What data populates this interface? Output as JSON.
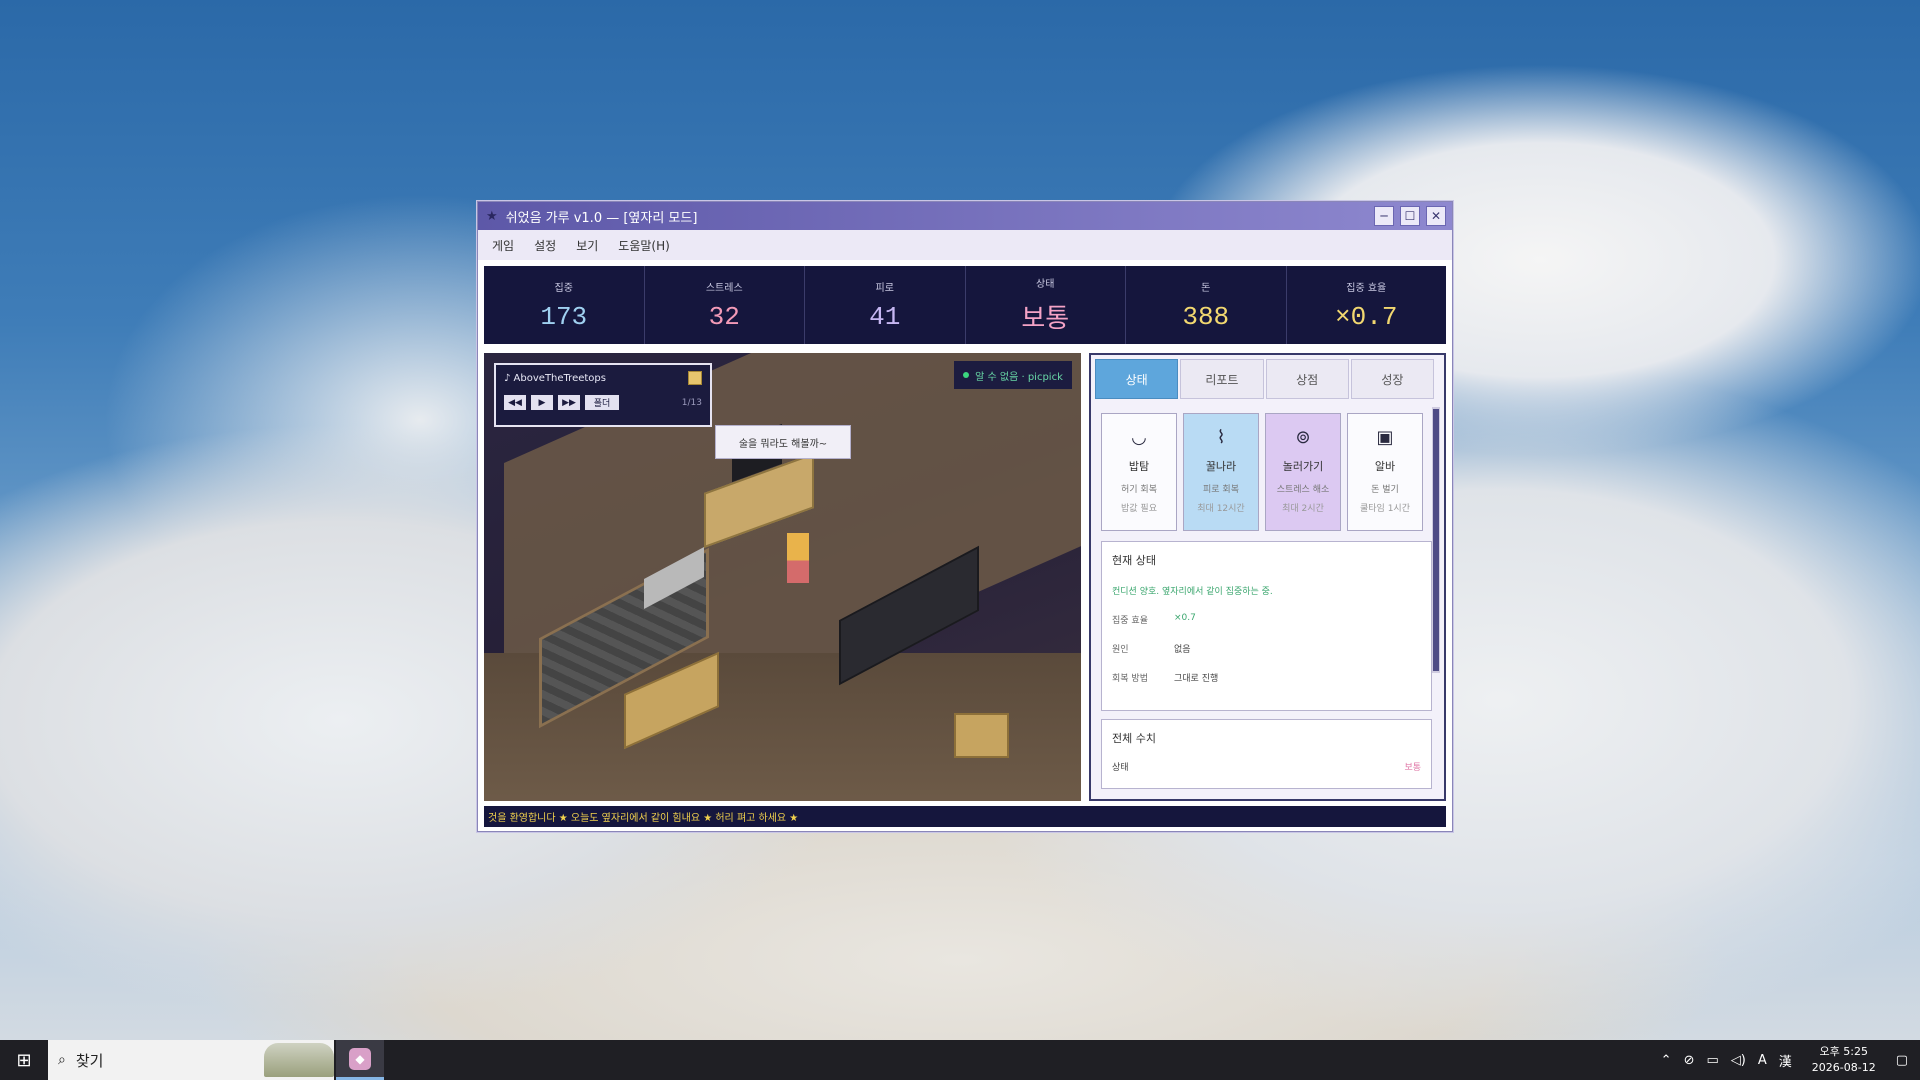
{
  "window": {
    "title": "쉬었음 가루 v1.0 — [옆자리 모드]",
    "title_icon": "star-icon",
    "controls": {
      "minimize": "─",
      "maximize": "☐",
      "close": "✕"
    }
  },
  "menu": [
    "게임",
    "설정",
    "보기",
    "도움말(H)"
  ],
  "stats": [
    {
      "label": "집중",
      "value": "173",
      "color": "#9fd0f0"
    },
    {
      "label": "스트레스",
      "value": "32",
      "color": "#f29ab7"
    },
    {
      "label": "피로",
      "value": "41",
      "color": "#c6b7f2"
    },
    {
      "label": "상태",
      "value": "보통",
      "color": "#f4a3c6"
    },
    {
      "label": "돈",
      "value": "388",
      "color": "#f2d870"
    },
    {
      "label": "집중 효율",
      "value": "×0.7",
      "color": "#f2d870"
    }
  ],
  "player": {
    "track": "♪ AboveTheTreetops",
    "prev": "◀◀",
    "play": "▶",
    "next": "▶▶",
    "folder_btn": "폴더",
    "count": "1/13"
  },
  "scene": {
    "bubble": "술을 뭐라도 해볼까~",
    "badge": "알 수 없음 · picpick"
  },
  "tabs": [
    "상태",
    "리포트",
    "상점",
    "성장"
  ],
  "actions": [
    {
      "icon": "bowl-icon",
      "glyph": "◡",
      "name": "밥탐",
      "d1": "허기 회복",
      "d2": "밥값 필요"
    },
    {
      "icon": "bed-icon",
      "glyph": "⌇",
      "name": "꿀나라",
      "d1": "피로 회복",
      "d2": "최대 12시간"
    },
    {
      "icon": "gamepad-icon",
      "glyph": "⊚",
      "name": "놀러가기",
      "d1": "스트레스 해소",
      "d2": "최대 2시간"
    },
    {
      "icon": "briefcase-icon",
      "glyph": "▣",
      "name": "알바",
      "d1": "돈 벌기",
      "d2": "쿨타임 1시간"
    }
  ],
  "status_card": {
    "title": "현재 상태",
    "desc": "컨디션 양호. 옆자리에서 같이 집중하는 중.",
    "rows": [
      {
        "k": "집중 효율",
        "v": "×0.7"
      },
      {
        "k": "원인",
        "v": "없음"
      },
      {
        "k": "회복 방법",
        "v": "그대로 진행"
      }
    ]
  },
  "total_card": {
    "title": "전체 수치",
    "row_label": "상태",
    "row_value": "보통"
  },
  "ticker": "것을 환영합니다 ★ 오늘도 옆자리에서 같이 힘내요 ★ 허리 펴고 하세요 ★",
  "taskbar": {
    "search_placeholder": "찾기",
    "clock_time": "오후 5:25",
    "clock_date": "2026-08-12",
    "ime": "A",
    "ime2": "漢"
  }
}
